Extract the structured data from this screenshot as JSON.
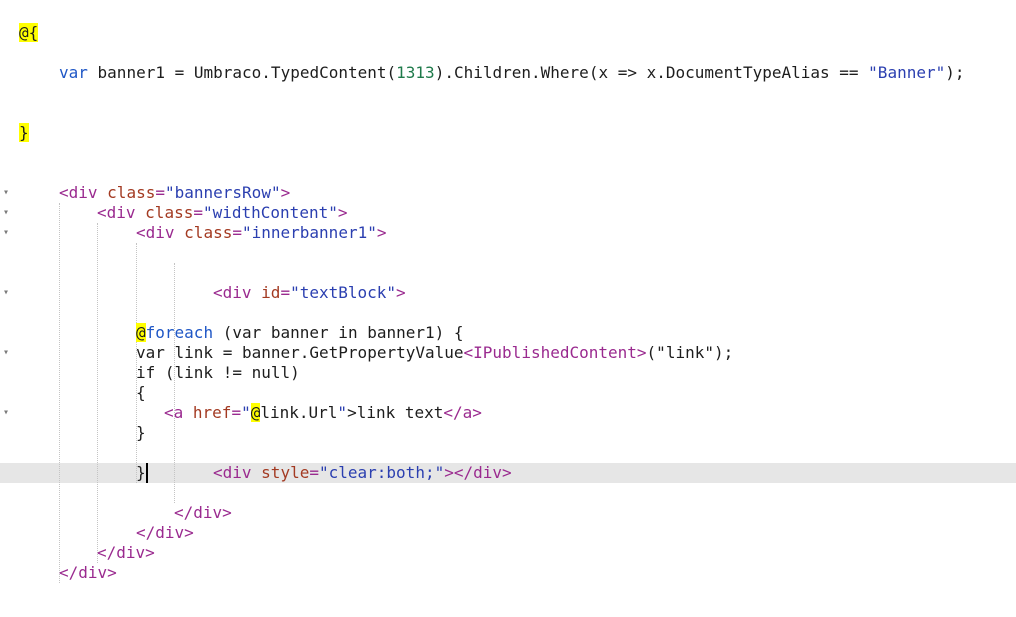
{
  "colors": {
    "razor_highlight": "#ffff00",
    "keyword": "#1f57c6",
    "html_tag": "#9a2a8f",
    "attribute": "#a33a22",
    "string": "#2b3fb0",
    "number": "#1e7a4a",
    "plain": "#1d1d1d",
    "current_line": "#e6e6e6",
    "fold_marker": "#7a7a7a"
  },
  "fold_icon": "chevron-down-icon",
  "lines": [
    {
      "tokens": [
        {
          "t": "@{",
          "c": "razor"
        }
      ]
    },
    {
      "tokens": [
        {
          "t": "var",
          "c": "keyword"
        },
        {
          "t": " banner1 = Umbraco.TypedContent(",
          "c": "plain"
        },
        {
          "t": "1313",
          "c": "number"
        },
        {
          "t": ").Children.Where(x => x.DocumentTypeAlias == ",
          "c": "plain"
        },
        {
          "t": "\"Banner\"",
          "c": "string"
        },
        {
          "t": ");",
          "c": "plain"
        }
      ]
    },
    {
      "tokens": [
        {
          "t": "}",
          "c": "razor"
        }
      ]
    },
    {
      "tokens": [
        {
          "t": "<div ",
          "c": "html_tag"
        },
        {
          "t": "class",
          "c": "attribute"
        },
        {
          "t": "=",
          "c": "html_tag"
        },
        {
          "t": "\"bannersRow\"",
          "c": "string"
        },
        {
          "t": ">",
          "c": "html_tag"
        }
      ]
    },
    {
      "tokens": [
        {
          "t": "<div ",
          "c": "html_tag"
        },
        {
          "t": "class",
          "c": "attribute"
        },
        {
          "t": "=",
          "c": "html_tag"
        },
        {
          "t": "\"widthContent\"",
          "c": "string"
        },
        {
          "t": ">",
          "c": "html_tag"
        }
      ]
    },
    {
      "tokens": [
        {
          "t": "<div ",
          "c": "html_tag"
        },
        {
          "t": "class",
          "c": "attribute"
        },
        {
          "t": "=",
          "c": "html_tag"
        },
        {
          "t": "\"innerbanner1\"",
          "c": "string"
        },
        {
          "t": ">",
          "c": "html_tag"
        }
      ]
    },
    {
      "tokens": [
        {
          "t": "<div ",
          "c": "html_tag"
        },
        {
          "t": "id",
          "c": "attribute"
        },
        {
          "t": "=",
          "c": "html_tag"
        },
        {
          "t": "\"textBlock\"",
          "c": "string"
        },
        {
          "t": ">",
          "c": "html_tag"
        }
      ]
    },
    {
      "tokens": [
        {
          "t": "@",
          "c": "razor"
        },
        {
          "t": "foreach",
          "c": "keyword"
        },
        {
          "t": " (var banner in banner1) {",
          "c": "plain"
        }
      ]
    },
    {
      "tokens": [
        {
          "t": "var link = banner.GetPropertyValue",
          "c": "plain"
        },
        {
          "t": "<IPublishedContent>",
          "c": "html_tag"
        },
        {
          "t": "(\"link\");",
          "c": "plain"
        }
      ]
    },
    {
      "tokens": [
        {
          "t": "if (link != null)",
          "c": "plain"
        }
      ]
    },
    {
      "tokens": [
        {
          "t": "{",
          "c": "plain"
        }
      ]
    },
    {
      "tokens": [
        {
          "t": "<a ",
          "c": "html_tag"
        },
        {
          "t": "href",
          "c": "attribute"
        },
        {
          "t": "=",
          "c": "html_tag"
        },
        {
          "t": "\"",
          "c": "string"
        },
        {
          "t": "@",
          "c": "razor"
        },
        {
          "t": "link.Url",
          "c": "plain"
        },
        {
          "t": "\"",
          "c": "string"
        },
        {
          "t": ">link text",
          "c": "plain"
        },
        {
          "t": "</a>",
          "c": "html_tag"
        }
      ]
    },
    {
      "tokens": [
        {
          "t": "}",
          "c": "plain"
        }
      ]
    },
    {
      "tokens": [
        {
          "t": "}",
          "c": "plain"
        }
      ]
    },
    {
      "tokens": [
        {
          "t": "<div ",
          "c": "html_tag"
        },
        {
          "t": "style",
          "c": "attribute"
        },
        {
          "t": "=",
          "c": "html_tag"
        },
        {
          "t": "\"clear:both;\"",
          "c": "string"
        },
        {
          "t": "></div>",
          "c": "html_tag"
        }
      ]
    },
    {
      "tokens": [
        {
          "t": "</div>",
          "c": "html_tag"
        }
      ]
    },
    {
      "tokens": [
        {
          "t": "</div>",
          "c": "html_tag"
        }
      ]
    },
    {
      "tokens": [
        {
          "t": "</div>",
          "c": "html_tag"
        }
      ]
    },
    {
      "tokens": [
        {
          "t": "</div>",
          "c": "html_tag"
        }
      ]
    }
  ]
}
